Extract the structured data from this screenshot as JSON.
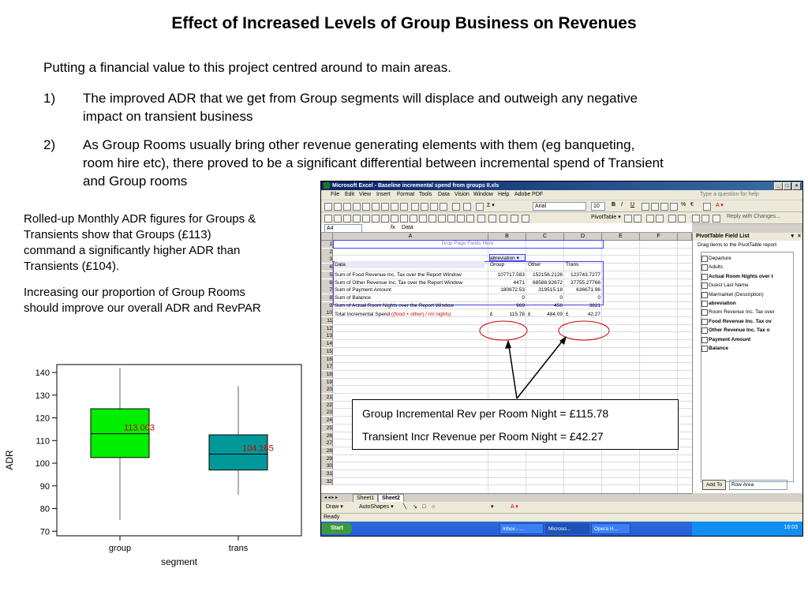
{
  "slide": {
    "title": "Effect of Increased Levels of Group Business on Revenues",
    "intro": "Putting a financial value to this project centred around to main areas.",
    "points": [
      {
        "num": "1)",
        "lines": [
          "The improved ADR that we get from Group segments will displace and outweigh any      negative",
          "impact on transient business"
        ]
      },
      {
        "num": "2)",
        "lines": [
          "As Group Rooms usually bring other revenue generating elements with them (eg banqueting,",
          "room hire etc), there proved to be a significant differential between incremental spend of Transient",
          "and Group rooms"
        ]
      }
    ],
    "side_paragraphs": [
      [
        "Rolled-up Monthly ADR figures for Groups &",
        "Transients show that Groups (£113)",
        "command a significantly higher ADR than",
        "Transients (£104)."
      ],
      [
        "Increasing our proportion of Group Rooms",
        "should improve our overall ADR and RevPAR"
      ]
    ],
    "callout": {
      "line1": "Group Incremental Rev per Room Night = £115.78",
      "line2": "Transient Incr Revenue per Room Night = £42.27"
    }
  },
  "excel": {
    "window_title": "Microsoft Excel - Baseline incremental spend from groups II.xls",
    "menu": [
      "File",
      "Edit",
      "View",
      "Insert",
      "Format",
      "Tools",
      "Data",
      "Vision",
      "Window",
      "Help",
      "Adobe PDF"
    ],
    "help_placeholder": "Type a question for help",
    "font_name": "Arial",
    "font_size": "10",
    "name_box": "A4",
    "fx": "fx",
    "formula": "Data",
    "pivottable_menu": "PivotTable ▾",
    "reply_changes": "Reply with Changes...",
    "columns": [
      "A",
      "B",
      "C",
      "D",
      "E",
      "F"
    ],
    "rows": [
      "1",
      "2",
      "3",
      "4",
      "5",
      "6",
      "7",
      "8",
      "9",
      "10",
      "11",
      "12",
      "13",
      "14",
      "15",
      "16",
      "17",
      "18",
      "19",
      "20",
      "21",
      "22",
      "23",
      "24",
      "25",
      "26",
      "27",
      "28",
      "29",
      "30",
      "31",
      "32"
    ],
    "drop_page_fields": "Drop Page Fields Here",
    "pivot_filter": "abreviation",
    "pivot_header": [
      "Data",
      "Group",
      "Other",
      "Trans"
    ],
    "pivot_rows": [
      {
        "label": "Sum of Food Revenue Inc. Tax over the Report Window",
        "b": "107717.583",
        "c": "152156.2126",
        "d": "123743.7277"
      },
      {
        "label": "Sum of Other Revenue Inc. Tax over the Report Window",
        "b": "4471",
        "c": "68588.92672",
        "d": "37755.27766"
      },
      {
        "label": "Sum of Payment Amount",
        "b": "180672.53",
        "c": "319515.18",
        "d": "636671.96"
      },
      {
        "label": "Sum of Balance",
        "b": "0",
        "c": "0",
        "d": "0"
      },
      {
        "label": "Sum of Actual Room Nights over the Report Window",
        "b": "969",
        "c": "456",
        "d": "3821"
      }
    ],
    "total_label": "Total Incremental Spend",
    "total_formula": "((food + other) / rm nights)",
    "totals": {
      "cur": "£",
      "b": "115.78",
      "c": "484.09",
      "d": "42.27"
    },
    "sheet_tabs": [
      "Sheet1",
      "Sheet2"
    ],
    "pivot_panel_title": "PivotTable Field List",
    "pivot_panel_hint": "Drag items to the PivotTable report",
    "fields": [
      {
        "name": "Departure",
        "bold": false
      },
      {
        "name": "Adults",
        "bold": false
      },
      {
        "name": "Actual Room Nights over t",
        "bold": true
      },
      {
        "name": "Guest Last Name",
        "bold": false
      },
      {
        "name": "Marmarket (Description)",
        "bold": false
      },
      {
        "name": "abreviation",
        "bold": true
      },
      {
        "name": "Room Revenue Inc. Tax over",
        "bold": false
      },
      {
        "name": "Food Revenue Inc. Tax ov",
        "bold": true
      },
      {
        "name": "Other Revenue Inc. Tax o",
        "bold": true
      },
      {
        "name": "Payment Amount",
        "bold": true
      },
      {
        "name": "Balance",
        "bold": true
      }
    ],
    "add_to": "Add To",
    "row_area": "Row Area",
    "draw_label": "Draw ▾",
    "autoshapes_label": "AutoShapes ▾",
    "status": "Ready",
    "start": "Start",
    "tasks": [
      "Inbox - ...",
      "Microso...",
      "Opera H..."
    ],
    "clock": "16:03"
  },
  "chart_data": {
    "type": "boxplot",
    "xlabel": "segment",
    "ylabel": "ADR",
    "ylim": [
      70,
      140
    ],
    "yticks": [
      70,
      80,
      90,
      100,
      110,
      120,
      130,
      140
    ],
    "categories": [
      "group",
      "trans"
    ],
    "boxes": [
      {
        "name": "group",
        "whisker_low": 75,
        "q1": 102.5,
        "median": 113,
        "q3": 124,
        "whisker_high": 142,
        "label": "113.003",
        "color": "#00ee00"
      },
      {
        "name": "trans",
        "whisker_low": 86,
        "q1": 97,
        "median": 104,
        "q3": 112.5,
        "whisker_high": 134,
        "label": "104.185",
        "color": "#009999"
      }
    ]
  },
  "colors": {
    "label_red": "#cc0000",
    "pivot_blue": "#4040ff",
    "arrow": "#000000"
  }
}
